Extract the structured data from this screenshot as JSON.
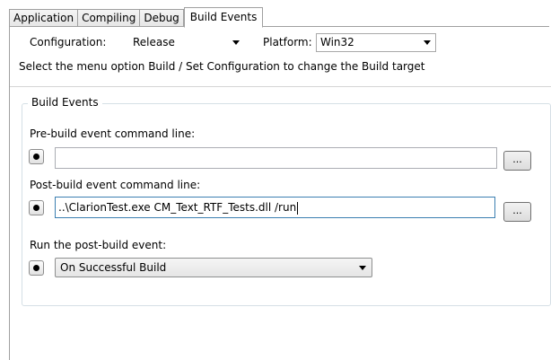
{
  "tabs": [
    {
      "label": "Application",
      "active": false
    },
    {
      "label": "Compiling",
      "active": false
    },
    {
      "label": "Debug",
      "active": false
    },
    {
      "label": "Build Events",
      "active": true
    }
  ],
  "config": {
    "configuration_label": "Configuration:",
    "configuration_value": "Release",
    "platform_label": "Platform:",
    "platform_value": "Win32",
    "hint": "Select the menu option Build / Set Configuration to change the Build target"
  },
  "group": {
    "title": "Build Events",
    "pre_label": "Pre-build event command line:",
    "pre_value": "",
    "pre_browse": "...",
    "post_label": "Post-build event command line:",
    "post_value": "..\\ClarionTest.exe CM_Text_RTF_Tests.dll /run",
    "post_browse": "...",
    "run_label": "Run the post-build event:",
    "run_value": "On Successful Build"
  }
}
